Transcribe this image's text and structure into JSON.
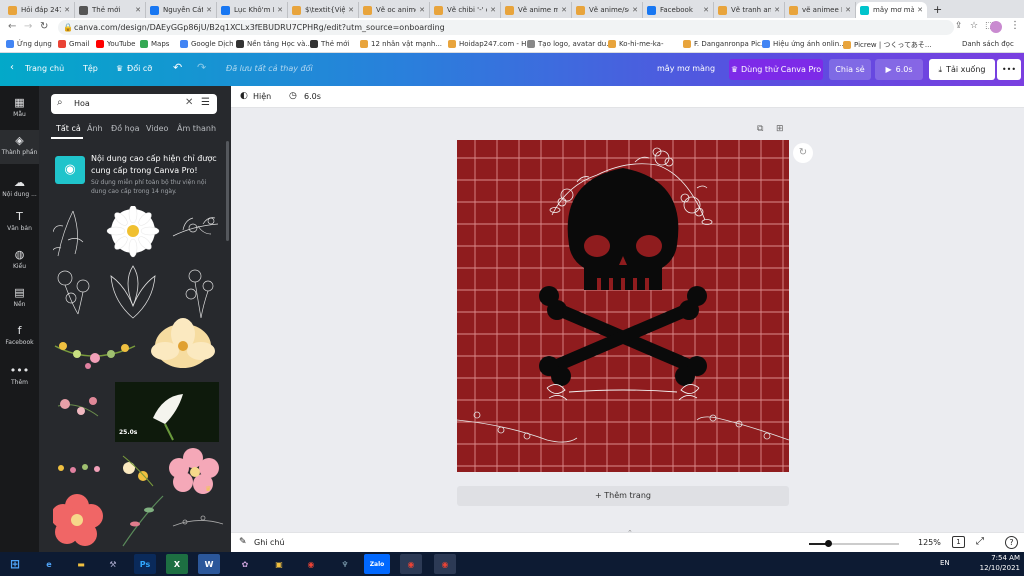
{
  "browser": {
    "tabs": [
      {
        "label": "Hỏi đáp 247",
        "color": "#e8a43c"
      },
      {
        "label": "Thẻ mới",
        "color": "#555555"
      },
      {
        "label": "Nguyễn Cát",
        "color": "#1877f2"
      },
      {
        "label": "Lục Khô'm P",
        "color": "#1877f2"
      },
      {
        "label": "$\\textit{Việt",
        "color": "#e8a43c"
      },
      {
        "label": "Vẽ oc anime",
        "color": "#e8a43c"
      },
      {
        "label": "Vẽ chibi '-' c",
        "color": "#e8a43c"
      },
      {
        "label": "Vẽ anime mi",
        "color": "#e8a43c"
      },
      {
        "label": "Vẽ anime/sc",
        "color": "#e8a43c"
      },
      {
        "label": "Facebook",
        "color": "#1877f2"
      },
      {
        "label": "Vẽ tranh anc",
        "color": "#e8a43c"
      },
      {
        "label": "vẽ animee F",
        "color": "#e8a43c"
      },
      {
        "label": "mây mơ màn",
        "color": "#00c4cc",
        "active": true
      }
    ],
    "new_tab": "+",
    "url": "canva.com/design/DAEyGGp86jU/B2q1XCLx3fEBUDRU7CPHRg/edit?utm_source=onboarding",
    "bookmarks": [
      {
        "label": "Ứng dụng",
        "color": "#4285f4"
      },
      {
        "label": "Gmail",
        "color": "#ea4335"
      },
      {
        "label": "YouTube",
        "color": "#ff0000"
      },
      {
        "label": "Maps",
        "color": "#34a853"
      },
      {
        "label": "Google Dịch",
        "color": "#4285f4"
      },
      {
        "label": "Nền tảng Học và...",
        "color": "#333333"
      },
      {
        "label": "Thẻ mới",
        "color": "#333333"
      },
      {
        "label": "12 nhân vật mạnh...",
        "color": "#e8a43c"
      },
      {
        "label": "Hoidap247.com - H...",
        "color": "#e8a43c"
      },
      {
        "label": "Tạo logo, avatar du...",
        "color": "#888888"
      },
      {
        "label": "Ko-hi-me-ka-",
        "color": "#e8a43c"
      },
      {
        "label": "F. Danganronpa Pic...",
        "color": "#e8a43c"
      },
      {
        "label": "Hiệu ứng ánh onlin...",
        "color": "#4285f4"
      },
      {
        "label": "Picrew | つくってあそ...",
        "color": "#e8a43c"
      }
    ],
    "other_bookmarks": "Danh sách đọc"
  },
  "canva": {
    "home": "Trang chủ",
    "file": "Tệp",
    "resize": "Đổi cỡ",
    "saved_status": "Đã lưu tất cả thay đổi",
    "design_title": "mây mơ màng",
    "try_pro": "Dùng thử Canva Pro",
    "share": "Chia sẻ",
    "play_duration": "6.0s",
    "download": "Tải xuống",
    "more": "•••"
  },
  "rail": [
    {
      "label": "Mẫu",
      "icon": "▦"
    },
    {
      "label": "Thành phần",
      "icon": "◈",
      "active": true
    },
    {
      "label": "Nội dung ...",
      "icon": "☁"
    },
    {
      "label": "Văn bản",
      "icon": "T"
    },
    {
      "label": "Kiểu",
      "icon": "◍"
    },
    {
      "label": "Nền",
      "icon": "▤"
    },
    {
      "label": "Facebook",
      "icon": "f"
    },
    {
      "label": "Thêm",
      "icon": "•••"
    }
  ],
  "panel": {
    "search_value": "Hoa",
    "tabs": [
      "Tất cả",
      "Ảnh",
      "Đồ họa",
      "Video",
      "Âm thanh"
    ],
    "promo_title": "Nội dung cao cấp hiện chỉ được cung cấp trong Canva Pro!",
    "promo_sub": "Sử dụng miễn phí toàn bộ thư viện nội dung cao cấp trong 14 ngày.",
    "video_duration": "25.0s"
  },
  "editor": {
    "animate": "Hiện",
    "duration": "6.0s",
    "add_page": "+ Thêm trang",
    "notes": "Ghi chú",
    "zoom": "125%",
    "page_number": "1",
    "help": "?"
  },
  "taskbar": {
    "language": "EN",
    "time": "7:54 AM",
    "date": "12/10/2021"
  },
  "colors": {
    "canvas_bg": "#8f1c1e",
    "grid": "#e9a0a0",
    "panel_bg": "#27292d",
    "rail_bg": "#18191b",
    "pro_button": "#7d2ae8"
  }
}
